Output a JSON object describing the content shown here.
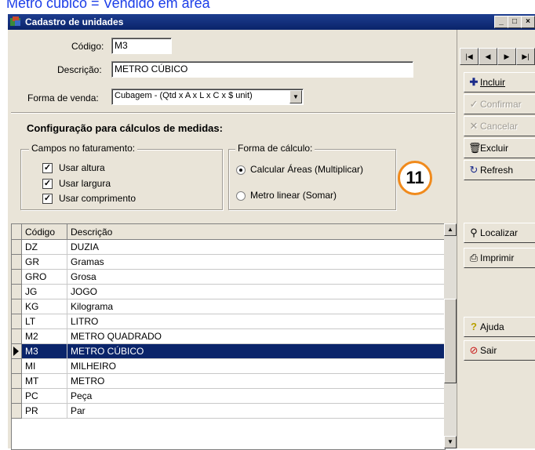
{
  "caption": "Metro cúbico = Vendido em área",
  "window": {
    "title": "Cadastro de unidades",
    "min_label": "_",
    "max_label": "□",
    "close_label": "×"
  },
  "form": {
    "codigo_label": "Código:",
    "codigo_value": "M3",
    "descricao_label": "Descrição:",
    "descricao_value": "METRO CÚBICO",
    "forma_venda_label": "Forma de venda:",
    "forma_venda_value": "Cubagem - (Qtd x A x L x C x $ unit)"
  },
  "config": {
    "title": "Configuração para cálculos de medidas:",
    "campos_legend": "Campos no faturamento:",
    "usar_altura": "Usar altura",
    "usar_largura": "Usar largura",
    "usar_comprimento": "Usar comprimento",
    "forma_legend": "Forma de cálculo:",
    "calcular_areas": "Calcular Áreas  (Multiplicar)",
    "metro_linear": "Metro linear  (Somar)"
  },
  "badge": "11",
  "grid": {
    "col_codigo": "Código",
    "col_descricao": "Descrição",
    "rows": [
      {
        "codigo": "DZ",
        "descricao": "DUZIA"
      },
      {
        "codigo": "GR",
        "descricao": "Gramas"
      },
      {
        "codigo": "GRO",
        "descricao": "Grosa"
      },
      {
        "codigo": "JG",
        "descricao": "JOGO"
      },
      {
        "codigo": "KG",
        "descricao": "Kilograma"
      },
      {
        "codigo": "LT",
        "descricao": "LITRO"
      },
      {
        "codigo": "M2",
        "descricao": "METRO QUADRADO"
      },
      {
        "codigo": "M3",
        "descricao": "METRO CÚBICO"
      },
      {
        "codigo": "MI",
        "descricao": "MILHEIRO"
      },
      {
        "codigo": "MT",
        "descricao": "METRO"
      },
      {
        "codigo": "PC",
        "descricao": "Peça"
      },
      {
        "codigo": "PR",
        "descricao": "Par"
      }
    ],
    "selected_index": 7
  },
  "actions": {
    "incluir": "Incluir",
    "confirmar": "Confirmar",
    "cancelar": "Cancelar",
    "excluir": "Excluir",
    "refresh": "Refresh",
    "localizar": "Localizar",
    "imprimir": "Imprimir",
    "ajuda": "Ajuda",
    "sair": "Sair"
  },
  "colors": {
    "caption": "#1c3ee8",
    "title_bar": "#0a246a",
    "selection": "#0a246a",
    "badge_ring": "#f08a1c",
    "face": "#e9e4d8"
  }
}
